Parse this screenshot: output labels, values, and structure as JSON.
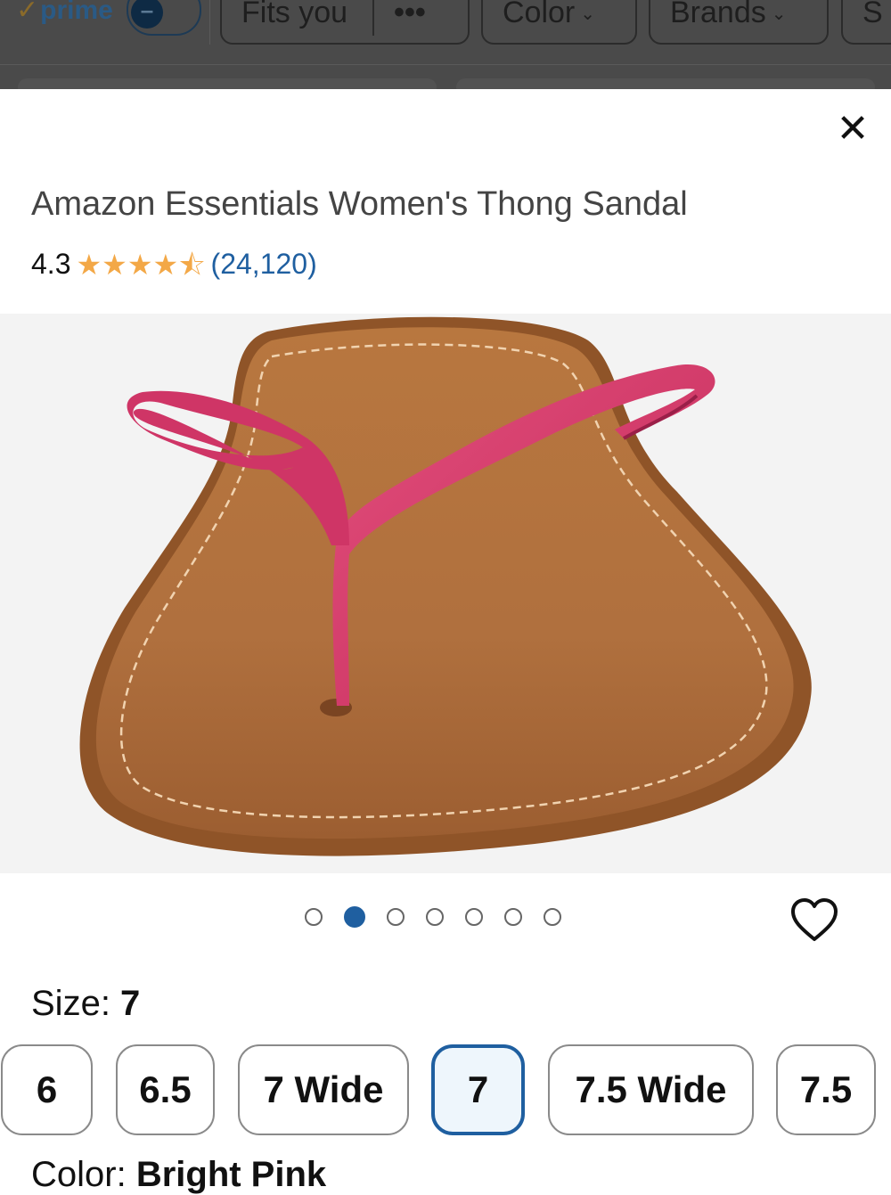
{
  "filter_bar": {
    "prime_check": "✓",
    "prime_label": "prime",
    "toggle_symbol": "–",
    "chips": [
      "Fits you",
      "Color",
      "Brands",
      "S"
    ],
    "more_label": "•••",
    "chevron": "⌄"
  },
  "product": {
    "title": "Amazon Essentials Women's Thong Sandal",
    "rating": "4.3",
    "stars": [
      "★",
      "★",
      "★",
      "★",
      "⯪"
    ],
    "review_count": "(24,120)"
  },
  "gallery": {
    "image_count": 7,
    "active_index": 1
  },
  "close_symbol": "✕",
  "size": {
    "label": "Size: ",
    "selected": "7",
    "options": [
      "6",
      "6.5",
      "7 Wide",
      "7",
      "7.5 Wide",
      "7.5"
    ]
  },
  "color": {
    "label": "Color: ",
    "selected": "Bright Pink"
  },
  "colors": {
    "accent": "#1f5fa0",
    "star": "#f3a847",
    "strap": "#d63a6a",
    "footbed": "#b57646"
  }
}
